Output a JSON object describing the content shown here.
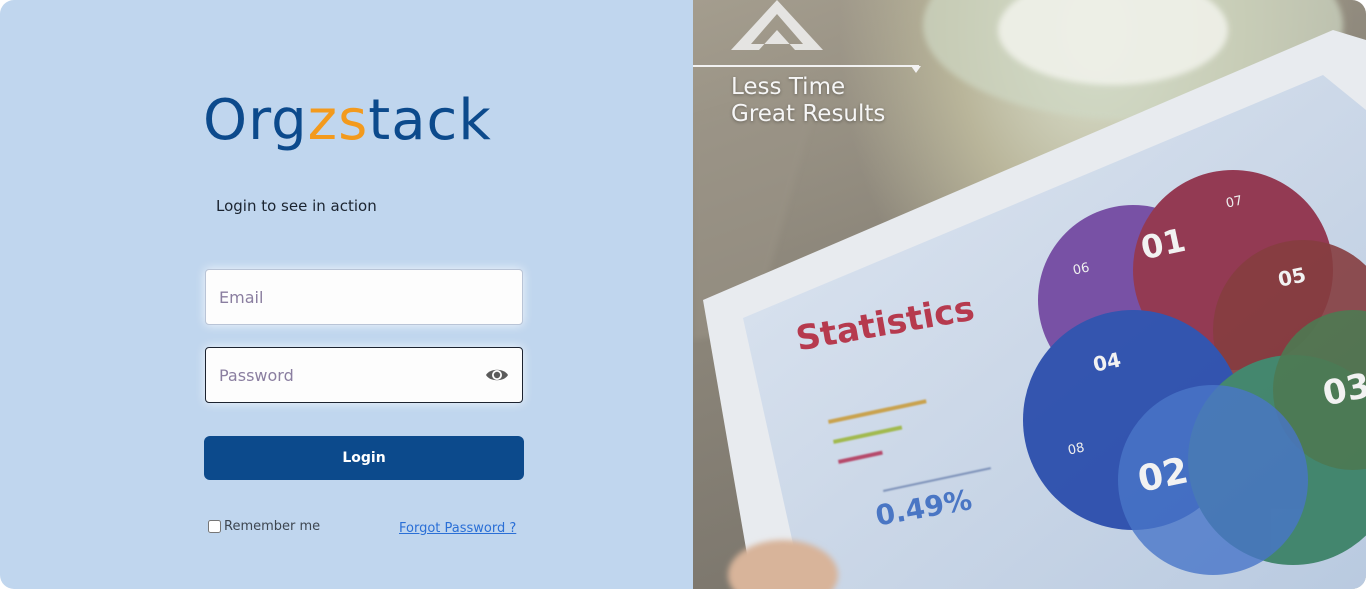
{
  "brand": {
    "name_part1": "Org",
    "name_accent": "zs",
    "name_part2": "tack",
    "tagline": "Login to see in action"
  },
  "form": {
    "email_placeholder": "Email",
    "email_value": "",
    "password_placeholder": "Password",
    "password_value": "",
    "show_password_icon": "eye-icon",
    "login_label": "Login",
    "remember_label": "Remember me",
    "remember_checked": false,
    "forgot_label": "Forgot Password ?"
  },
  "hero": {
    "slogan_line1": "Less Time",
    "slogan_line2": "Great Results",
    "tablet_title": "Statistics",
    "tablet_percent": "0.49%",
    "circle_labels": [
      "01",
      "02",
      "03",
      "04",
      "05",
      "06",
      "07",
      "08"
    ]
  },
  "colors": {
    "panel_bg": "#c0d6ee",
    "brand_blue": "#0c4a8c",
    "brand_orange": "#f39a1d",
    "link_blue": "#2a6fd6"
  }
}
